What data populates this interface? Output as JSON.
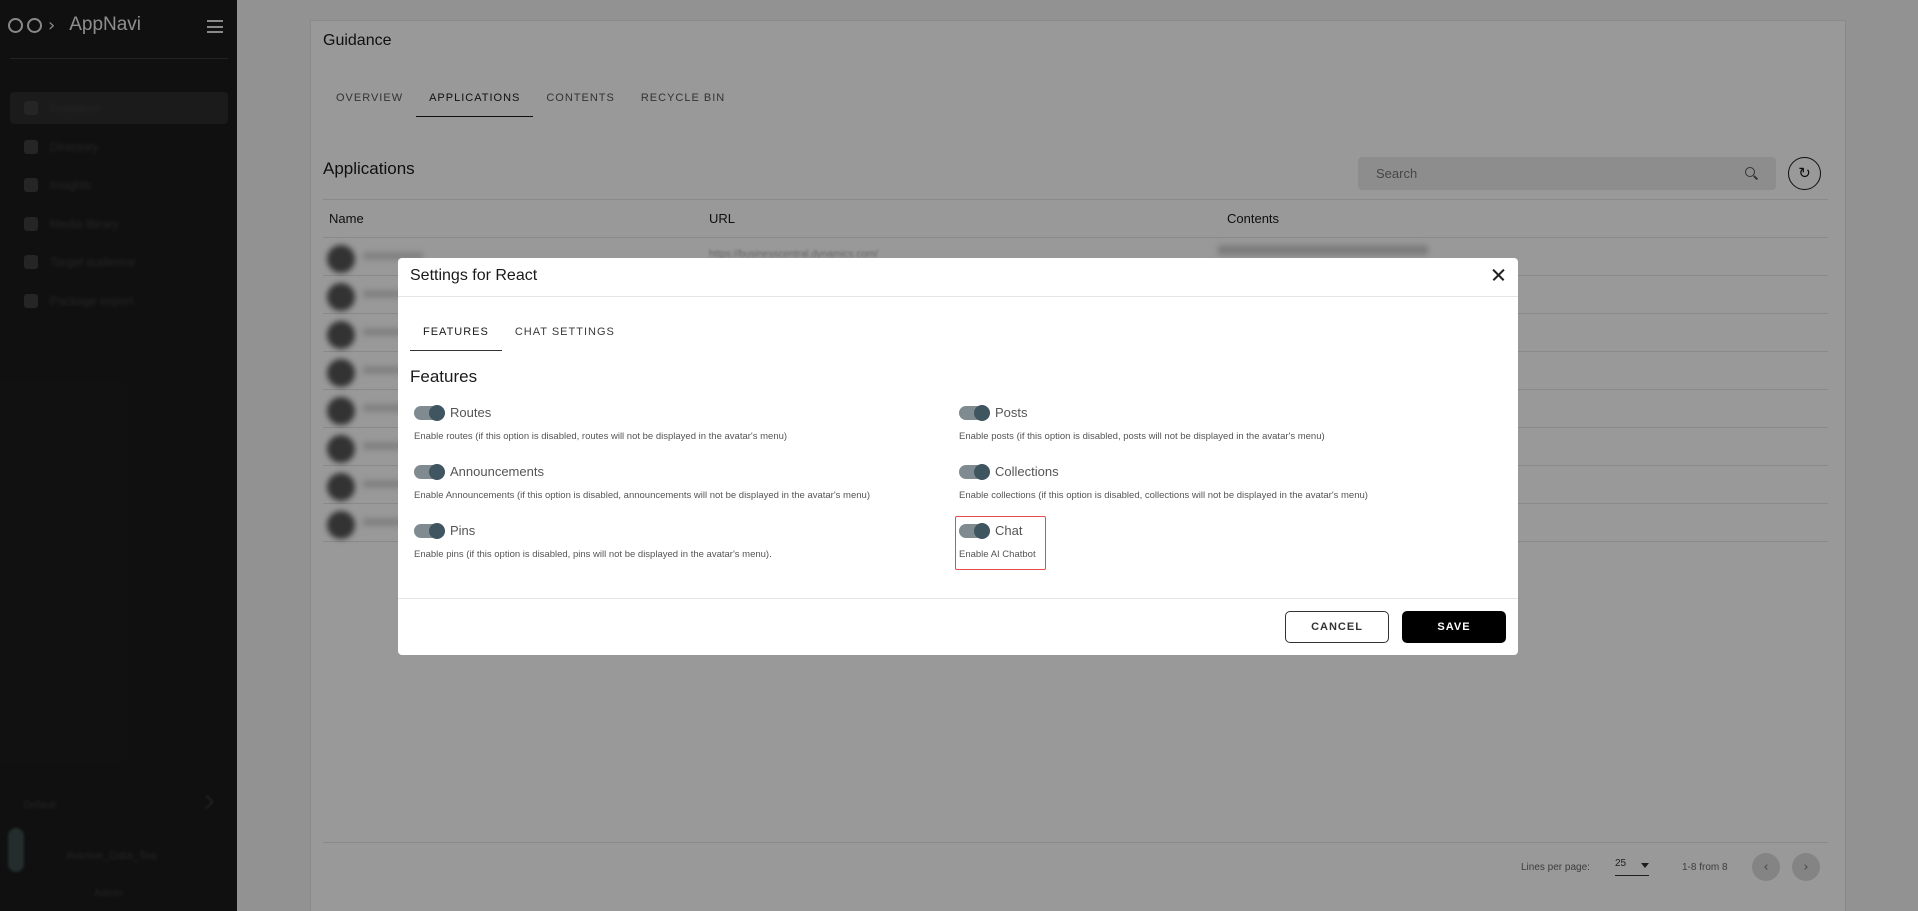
{
  "app": {
    "brand": "AppNavi"
  },
  "sidebar": {
    "items": [
      {
        "label": "Guidance",
        "active": true
      },
      {
        "label": "Directory"
      },
      {
        "label": "Insights"
      },
      {
        "label": "Media library"
      },
      {
        "label": "Target audience"
      },
      {
        "label": "Package export"
      }
    ],
    "footer_label": "Default",
    "user": {
      "name": "Avenue_Data_Tea",
      "role": "Admin"
    }
  },
  "page": {
    "title": "Guidance",
    "tabs": [
      "OVERVIEW",
      "APPLICATIONS",
      "CONTENTS",
      "RECYCLE BIN"
    ],
    "active_tab": "APPLICATIONS",
    "section_title": "Applications",
    "search": {
      "placeholder": "Search"
    },
    "table": {
      "headers": {
        "name": "Name",
        "url": "URL",
        "contents": "Contents"
      },
      "first_row_url": "https://businesscentral.dynamics.com/"
    },
    "pagination": {
      "lines_per_page_label": "Lines per page:",
      "lines_per_page": "25",
      "range": "1-8 from 8"
    }
  },
  "modal": {
    "title": "Settings for React",
    "tabs": [
      "FEATURES",
      "CHAT SETTINGS"
    ],
    "active_tab": "FEATURES",
    "section_title": "Features",
    "features": [
      {
        "label": "Routes",
        "description": "Enable routes (if this option is disabled, routes will not be displayed in the avatar's menu)",
        "enabled": true
      },
      {
        "label": "Posts",
        "description": "Enable posts (if this option is disabled, posts will not be displayed in the avatar's menu)",
        "enabled": true
      },
      {
        "label": "Announcements",
        "description": "Enable Announcements (if this option is disabled, announcements will not be displayed in the avatar's menu)",
        "enabled": true
      },
      {
        "label": "Collections",
        "description": "Enable collections (if this option is disabled, collections will not be displayed in the avatar's menu)",
        "enabled": true
      },
      {
        "label": "Pins",
        "description": "Enable pins (if this option is disabled, pins will not be displayed in the avatar's menu).",
        "enabled": true
      },
      {
        "label": "Chat",
        "description": "Enable AI Chatbot",
        "enabled": true
      }
    ],
    "cancel_label": "CANCEL",
    "save_label": "SAVE"
  },
  "colors": {
    "sidebar_bg": "#1c1c1c",
    "toggle_track": "#7f8b90",
    "toggle_knob": "#3f5560",
    "highlight": "#e54b4b",
    "primary_button": "#000000"
  },
  "icons": {
    "menu": "hamburger-icon",
    "search": "search-icon",
    "refresh": "refresh-icon",
    "close": "close-icon",
    "prev": "chevron-left-icon",
    "next": "chevron-right-icon"
  }
}
